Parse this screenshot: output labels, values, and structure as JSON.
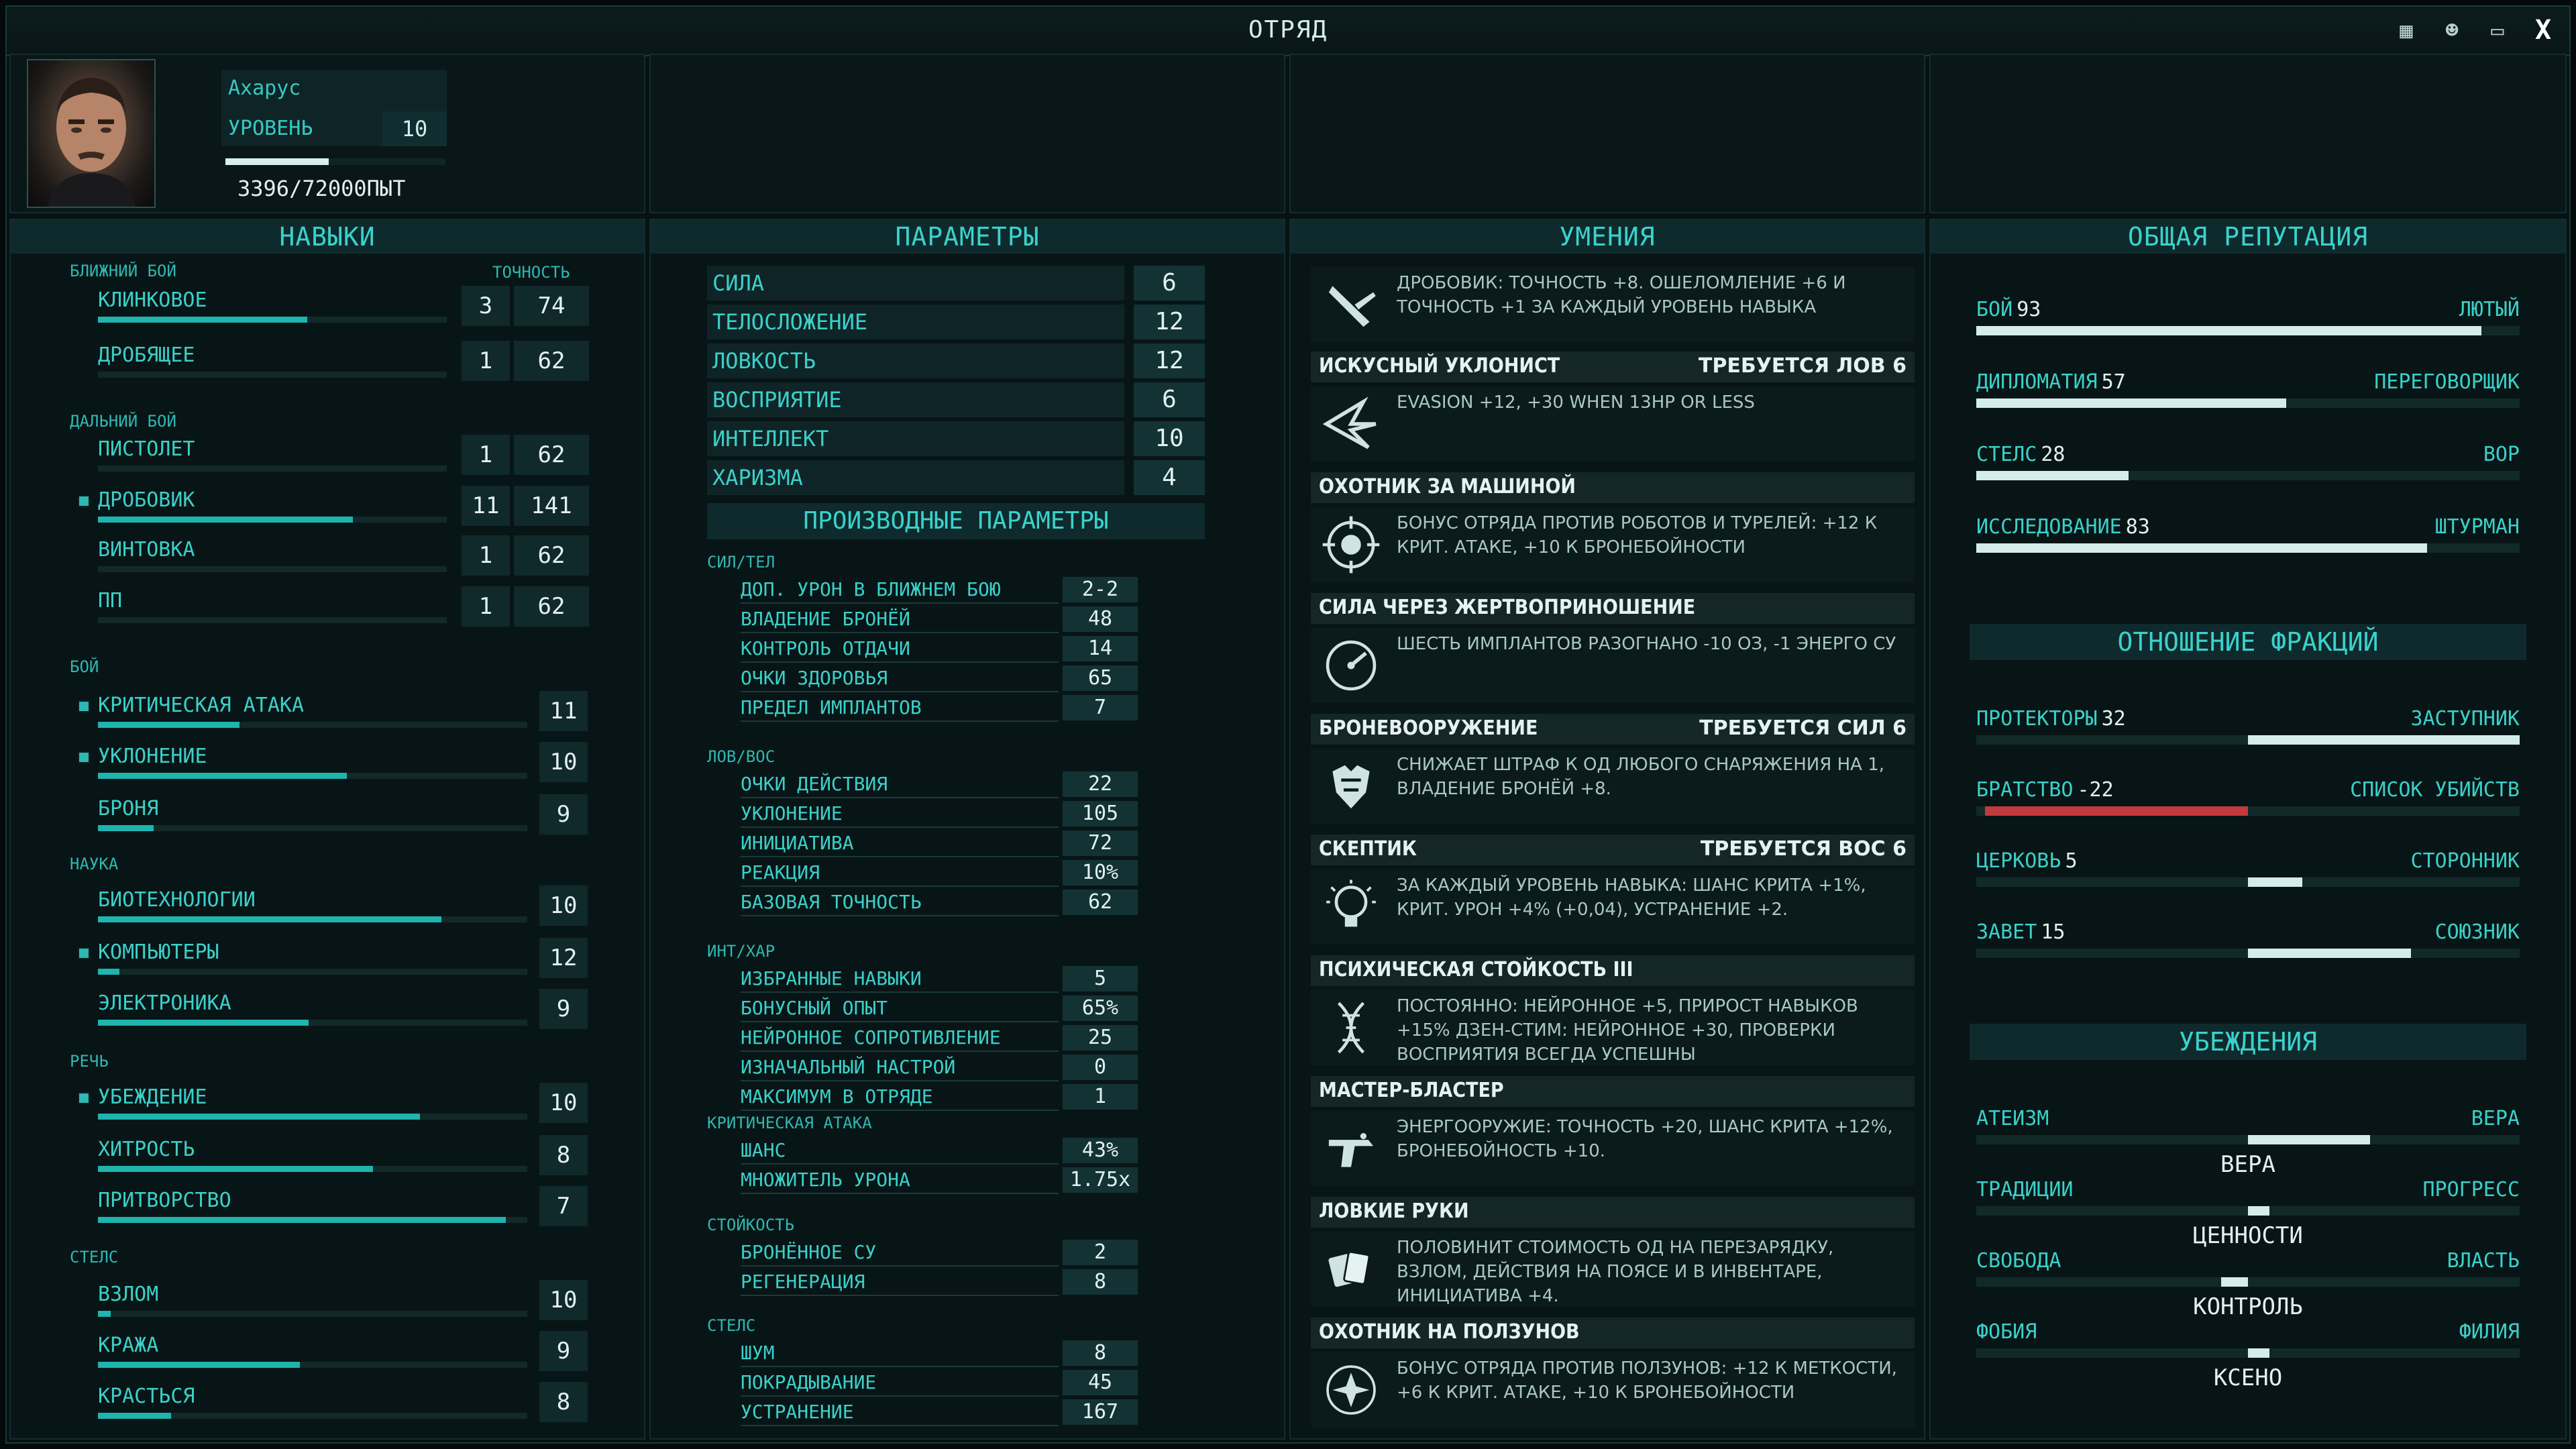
{
  "window": {
    "title": "ОТРЯД"
  },
  "character": {
    "name": "Ахарус",
    "level_label": "УРОВЕНЬ",
    "level": "10",
    "xp_text": "3396/72000ПЫТ",
    "xp_progress": 0.47
  },
  "skills": {
    "title": "НАВЫКИ",
    "accuracy_label": "ТОЧНОСТЬ",
    "melee": {
      "label": "БЛИЖНИЙ БОЙ",
      "items": [
        {
          "name": "КЛИНКОВОЕ",
          "level": "3",
          "accuracy": "74",
          "progress": 0.6
        },
        {
          "name": "ДРОБЯЩЕЕ",
          "level": "1",
          "accuracy": "62",
          "progress": 0.0
        }
      ]
    },
    "ranged": {
      "label": "ДАЛЬНИЙ БОЙ",
      "items": [
        {
          "name": "ПИСТОЛЕТ",
          "level": "1",
          "accuracy": "62",
          "progress": 0.0
        },
        {
          "name": "ДРОБОВИК",
          "level": "11",
          "accuracy": "141",
          "progress": 0.73
        },
        {
          "name": "ВИНТОВКА",
          "level": "1",
          "accuracy": "62",
          "progress": 0.0
        },
        {
          "name": "ПП",
          "level": "1",
          "accuracy": "62",
          "progress": 0.0
        }
      ]
    },
    "combat": {
      "label": "БОЙ",
      "items": [
        {
          "name": "КРИТИЧЕСКАЯ АТАКА",
          "level": "11",
          "progress": 0.33
        },
        {
          "name": "УКЛОНЕНИЕ",
          "level": "10",
          "progress": 0.58
        },
        {
          "name": "БРОНЯ",
          "level": "9",
          "progress": 0.13
        }
      ]
    },
    "science": {
      "label": "НАУКА",
      "items": [
        {
          "name": "БИОТЕХНОЛОГИИ",
          "level": "10",
          "progress": 0.8
        },
        {
          "name": "КОМПЬЮТЕРЫ",
          "level": "12",
          "progress": 0.05
        },
        {
          "name": "ЭЛЕКТРОНИКА",
          "level": "9",
          "progress": 0.49
        }
      ]
    },
    "speech": {
      "label": "РЕЧЬ",
      "items": [
        {
          "name": "УБЕЖДЕНИЕ",
          "level": "10",
          "progress": 0.75
        },
        {
          "name": "ХИТРОСТЬ",
          "level": "8",
          "progress": 0.64
        },
        {
          "name": "ПРИТВОРСТВО",
          "level": "7",
          "progress": 0.95
        }
      ]
    },
    "stealth": {
      "label": "СТЕЛС",
      "items": [
        {
          "name": "ВЗЛОМ",
          "level": "10",
          "progress": 0.03
        },
        {
          "name": "КРАЖА",
          "level": "9",
          "progress": 0.47
        },
        {
          "name": "КРАСТЬСЯ",
          "level": "8",
          "progress": 0.17
        }
      ]
    }
  },
  "params": {
    "title": "ПАРАМЕТРЫ",
    "main": [
      {
        "name": "СИЛА",
        "value": "6"
      },
      {
        "name": "ТЕЛОСЛОЖЕНИЕ",
        "value": "12"
      },
      {
        "name": "ЛОВКОСТЬ",
        "value": "12"
      },
      {
        "name": "ВОСПРИЯТИЕ",
        "value": "6"
      },
      {
        "name": "ИНТЕЛЛЕКТ",
        "value": "10"
      },
      {
        "name": "ХАРИЗМА",
        "value": "4"
      }
    ],
    "derived_title": "ПРОИЗВОДНЫЕ ПАРАМЕТРЫ",
    "groups": [
      {
        "label": "СИЛ/ТЕЛ",
        "rows": [
          {
            "name": "ДОП. УРОН В БЛИЖНЕМ БОЮ",
            "value": "2-2"
          },
          {
            "name": "ВЛАДЕНИЕ БРОНЁЙ",
            "value": "48"
          },
          {
            "name": "КОНТРОЛЬ ОТДАЧИ",
            "value": "14"
          },
          {
            "name": "ОЧКИ ЗДОРОВЬЯ",
            "value": "65"
          },
          {
            "name": "ПРЕДЕЛ ИМПЛАНТОВ",
            "value": "7"
          }
        ]
      },
      {
        "label": "ЛОВ/ВОС",
        "rows": [
          {
            "name": "ОЧКИ ДЕЙСТВИЯ",
            "value": "22"
          },
          {
            "name": "УКЛОНЕНИЕ",
            "value": "105"
          },
          {
            "name": "ИНИЦИАТИВА",
            "value": "72"
          },
          {
            "name": "РЕАКЦИЯ",
            "value": "10%"
          },
          {
            "name": "БАЗОВАЯ ТОЧНОСТЬ",
            "value": "62"
          }
        ]
      },
      {
        "label": "ИНТ/ХАР",
        "rows": [
          {
            "name": "ИЗБРАННЫЕ НАВЫКИ",
            "value": "5"
          },
          {
            "name": "БОНУСНЫЙ ОПЫТ",
            "value": "65%"
          },
          {
            "name": "НЕЙРОННОЕ СОПРОТИВЛЕНИЕ",
            "value": "25"
          },
          {
            "name": "ИЗНАЧАЛЬНЫЙ НАСТРОЙ",
            "value": "0"
          },
          {
            "name": "МАКСИМУМ В ОТРЯДЕ",
            "value": "1"
          }
        ]
      },
      {
        "label": "КРИТИЧЕСКАЯ АТАКА",
        "rows": [
          {
            "name": "ШАНС",
            "value": "43%"
          },
          {
            "name": "МНОЖИТЕЛЬ УРОНА",
            "value": "1.75x"
          }
        ]
      },
      {
        "label": "СТОЙКОСТЬ",
        "rows": [
          {
            "name": "БРОНЁННОЕ СУ",
            "value": "2"
          },
          {
            "name": "РЕГЕНЕРАЦИЯ",
            "value": "8"
          }
        ]
      },
      {
        "label": "СТЕЛС",
        "rows": [
          {
            "name": "ШУМ",
            "value": "8"
          },
          {
            "name": "ПОКРАДЫВАНИЕ",
            "value": "45"
          },
          {
            "name": "УСТРАНЕНИЕ",
            "value": "167"
          }
        ]
      }
    ]
  },
  "abilities": {
    "title": "УМЕНИЯ",
    "items": [
      {
        "name": "",
        "requirement": "",
        "icon": "shotgun-icon",
        "desc": "ДРОБОВИК: ТОЧНОСТЬ +8. ОШЕЛОМЛЕНИЕ +6 И ТОЧНОСТЬ +1 ЗА КАЖДЫЙ УРОВЕНЬ НАВЫКА"
      },
      {
        "name": "ИСКУСНЫЙ УКЛОНИСТ",
        "requirement": "ТРЕБУЕТСЯ ЛОВ 6",
        "icon": "evasion-icon",
        "desc": "EVASION +12, +30 WHEN 13HP OR LESS"
      },
      {
        "name": "ОХОТНИК ЗА МАШИНОЙ",
        "requirement": "",
        "icon": "target-icon",
        "desc": "БОНУС ОТРЯДА ПРОТИВ РОБОТОВ И ТУРЕЛЕЙ: +12 К КРИТ. АТАКЕ, +10 К БРОНЕБОЙНОСТИ"
      },
      {
        "name": "СИЛА ЧЕРЕЗ ЖЕРТВОПРИНОШЕНИЕ",
        "requirement": "",
        "icon": "gauge-icon",
        "desc": "ШЕСТЬ ИМПЛАНТОВ РАЗОГНАНО -10 ОЗ, -1 ЭНЕРГО СУ"
      },
      {
        "name": "БРОНЕВООРУЖЕНИЕ",
        "requirement": "ТРЕБУЕТСЯ СИЛ 6",
        "icon": "armor-icon",
        "desc": "СНИЖАЕТ ШТРАФ К ОД ЛЮБОГО СНАРЯЖЕНИЯ НА 1, ВЛАДЕНИЕ БРОНЁЙ +8."
      },
      {
        "name": "СКЕПТИК",
        "requirement": "ТРЕБУЕТСЯ ВОС 6",
        "icon": "bulb-icon",
        "desc": "ЗА КАЖДЫЙ УРОВЕНЬ НАВЫКА: ШАНС КРИТА +1%, КРИТ. УРОН +4% (+0,04), УСТРАНЕНИЕ +2."
      },
      {
        "name": "ПСИХИЧЕСКАЯ СТОЙКОСТЬ III",
        "requirement": "",
        "icon": "dna-icon",
        "desc": "ПОСТОЯННО: НЕЙРОННОЕ +5, ПРИРОСТ НАВЫКОВ +15% ДЗЕН-СТИМ: НЕЙРОННОЕ +30, ПРОВЕРКИ ВОСПРИЯТИЯ ВСЕГДА УСПЕШНЫ"
      },
      {
        "name": "МАСТЕР-БЛАСТЕР",
        "requirement": "",
        "icon": "blaster-icon",
        "desc": "ЭНЕРГООРУЖИЕ: ТОЧНОСТЬ +20, ШАНС КРИТА +12%, БРОНЕБОЙНОСТЬ +10."
      },
      {
        "name": "ЛОВКИЕ РУКИ",
        "requirement": "",
        "icon": "cards-icon",
        "desc": "ПОЛОВИНИТ СТОИМОСТЬ ОД НА ПЕРЕЗАРЯДКУ, ВЗЛОМ, ДЕЙСТВИЯ НА ПОЯСЕ И В ИНВЕНТАРЕ, ИНИЦИАТИВА +4."
      },
      {
        "name": "ОХОТНИК НА ПОЛЗУНОВ",
        "requirement": "",
        "icon": "crawler-icon",
        "desc": "БОНУС ОТРЯДА ПРОТИВ ПОЛЗУНОВ: +12 К МЕТКОСТИ, +6 К КРИТ. АТАКЕ, +10 К БРОНЕБОЙНОСТИ"
      }
    ]
  },
  "reputation": {
    "title": "ОБЩАЯ РЕПУТАЦИЯ",
    "items": [
      {
        "name": "БОЙ",
        "value": "93",
        "rank": "ЛЮТЫЙ",
        "fill": 0.93
      },
      {
        "name": "ДИПЛОМАТИЯ",
        "value": "57",
        "rank": "ПЕРЕГОВОРЩИК",
        "fill": 0.57
      },
      {
        "name": "СТЕЛС",
        "value": "28",
        "rank": "ВОР",
        "fill": 0.28
      },
      {
        "name": "ИССЛЕДОВАНИЕ",
        "value": "83",
        "rank": "ШТУРМАН",
        "fill": 0.83
      }
    ],
    "factions_title": "ОТНОШЕНИЕ ФРАКЦИЙ",
    "factions": [
      {
        "name": "ПРОТЕКТОРЫ",
        "value": "32",
        "rank": "ЗАСТУПНИК",
        "fill": 0.32
      },
      {
        "name": "БРАТСТВО",
        "value": "-22",
        "rank": "СПИСОК УБИЙСТВ",
        "fill": -0.22
      },
      {
        "name": "ЦЕРКОВЬ",
        "value": "5",
        "rank": "СТОРОННИК",
        "fill": 0.05
      },
      {
        "name": "ЗАВЕТ",
        "value": "15",
        "rank": "СОЮЗНИК",
        "fill": 0.15
      }
    ],
    "beliefs_title": "УБЕЖДЕНИЯ",
    "beliefs": [
      {
        "left": "АТЕИЗМ",
        "right": "ВЕРА",
        "center": "ВЕРА",
        "value": 0.45
      },
      {
        "left": "ТРАДИЦИИ",
        "right": "ПРОГРЕСС",
        "center": "ЦЕННОСТИ",
        "value": 0.0
      },
      {
        "left": "СВОБОДА",
        "right": "ВЛАСТЬ",
        "center": "КОНТРОЛЬ",
        "value": -0.1
      },
      {
        "left": "ФОБИЯ",
        "right": "ФИЛИЯ",
        "center": "КСЕНО",
        "value": 0.05
      }
    ]
  },
  "colors": {
    "accent": "#38c9c4",
    "bar": "#1fb4ae",
    "negative": "#c23a3c",
    "bg": "#071213"
  }
}
